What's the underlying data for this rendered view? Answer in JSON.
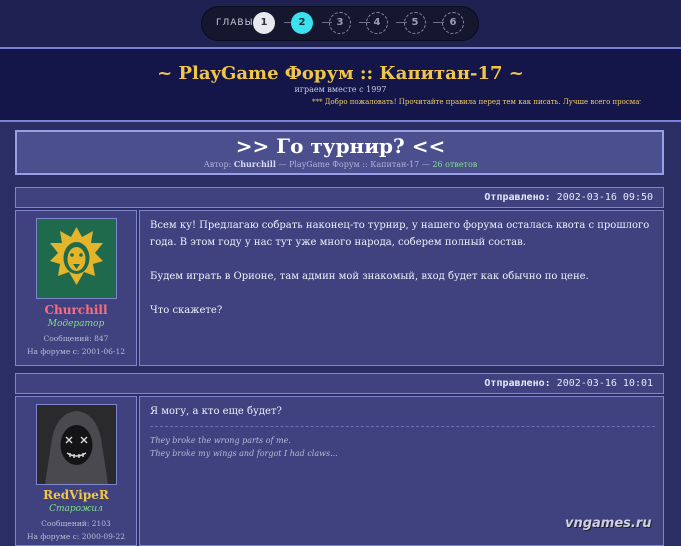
{
  "chapters": {
    "label": "ГЛАВЫ",
    "items": [
      {
        "n": "1",
        "state": "done"
      },
      {
        "n": "2",
        "state": "current"
      },
      {
        "n": "3",
        "state": "todo"
      },
      {
        "n": "4",
        "state": "todo"
      },
      {
        "n": "5",
        "state": "todo"
      },
      {
        "n": "6",
        "state": "todo"
      }
    ]
  },
  "forum": {
    "title": "~ PlayGame Форум :: Капитан-17 ~",
    "tagline": "играем вместе с 1997",
    "marquee": "*** Добро пожаловать! Прочитайте правила перед тем как писать. Лучше всего просматривать в Netscape"
  },
  "thread": {
    "title": ">> Го турнир? <<",
    "meta_prefix": "Автор:",
    "author": "Churchill",
    "meta_mid": "— PlayGame Форум :: Капитан-17 —",
    "replies": "26 ответов"
  },
  "posts": [
    {
      "sent_label": "Отправлено:",
      "sent_time": "2002-03-16 09:50",
      "user": {
        "name": "Churchill",
        "name_color": "#ff6b7e",
        "role": "Модератор",
        "messages": "Сообщений: 847",
        "since": "На форуме с: 2001-06-12",
        "avatar": "lion-avatar"
      },
      "paragraphs": [
        "Всем ку! Предлагаю собрать наконец-то турнир, у нашего форума осталась квота с прошлого года. В этом году у нас тут уже много народа, соберем полный состав.",
        "Будем играть в Орионе, там админ мой знакомый, вход будет как обычно по цене.",
        "Что скажете?"
      ]
    },
    {
      "sent_label": "Отправлено:",
      "sent_time": "2002-03-16 10:01",
      "user": {
        "name": "RedVipeR",
        "name_color": "#f0c64a",
        "role": "Старожил",
        "messages": "Сообщений: 2103",
        "since": "На форуме с: 2000-09-22",
        "avatar": "hooded-figure-avatar"
      },
      "paragraphs": [
        "Я могу, а кто еще будет?"
      ],
      "signature": [
        "They broke the wrong parts of me.",
        "They broke my wings and forgot I had claws..."
      ]
    }
  ],
  "watermark": "vngames.ru",
  "colors": {
    "accent": "#f0c64a",
    "current_chapter": "#3ce1ef",
    "moderator_name": "#ff6b7e",
    "role": "#7fe08a"
  }
}
